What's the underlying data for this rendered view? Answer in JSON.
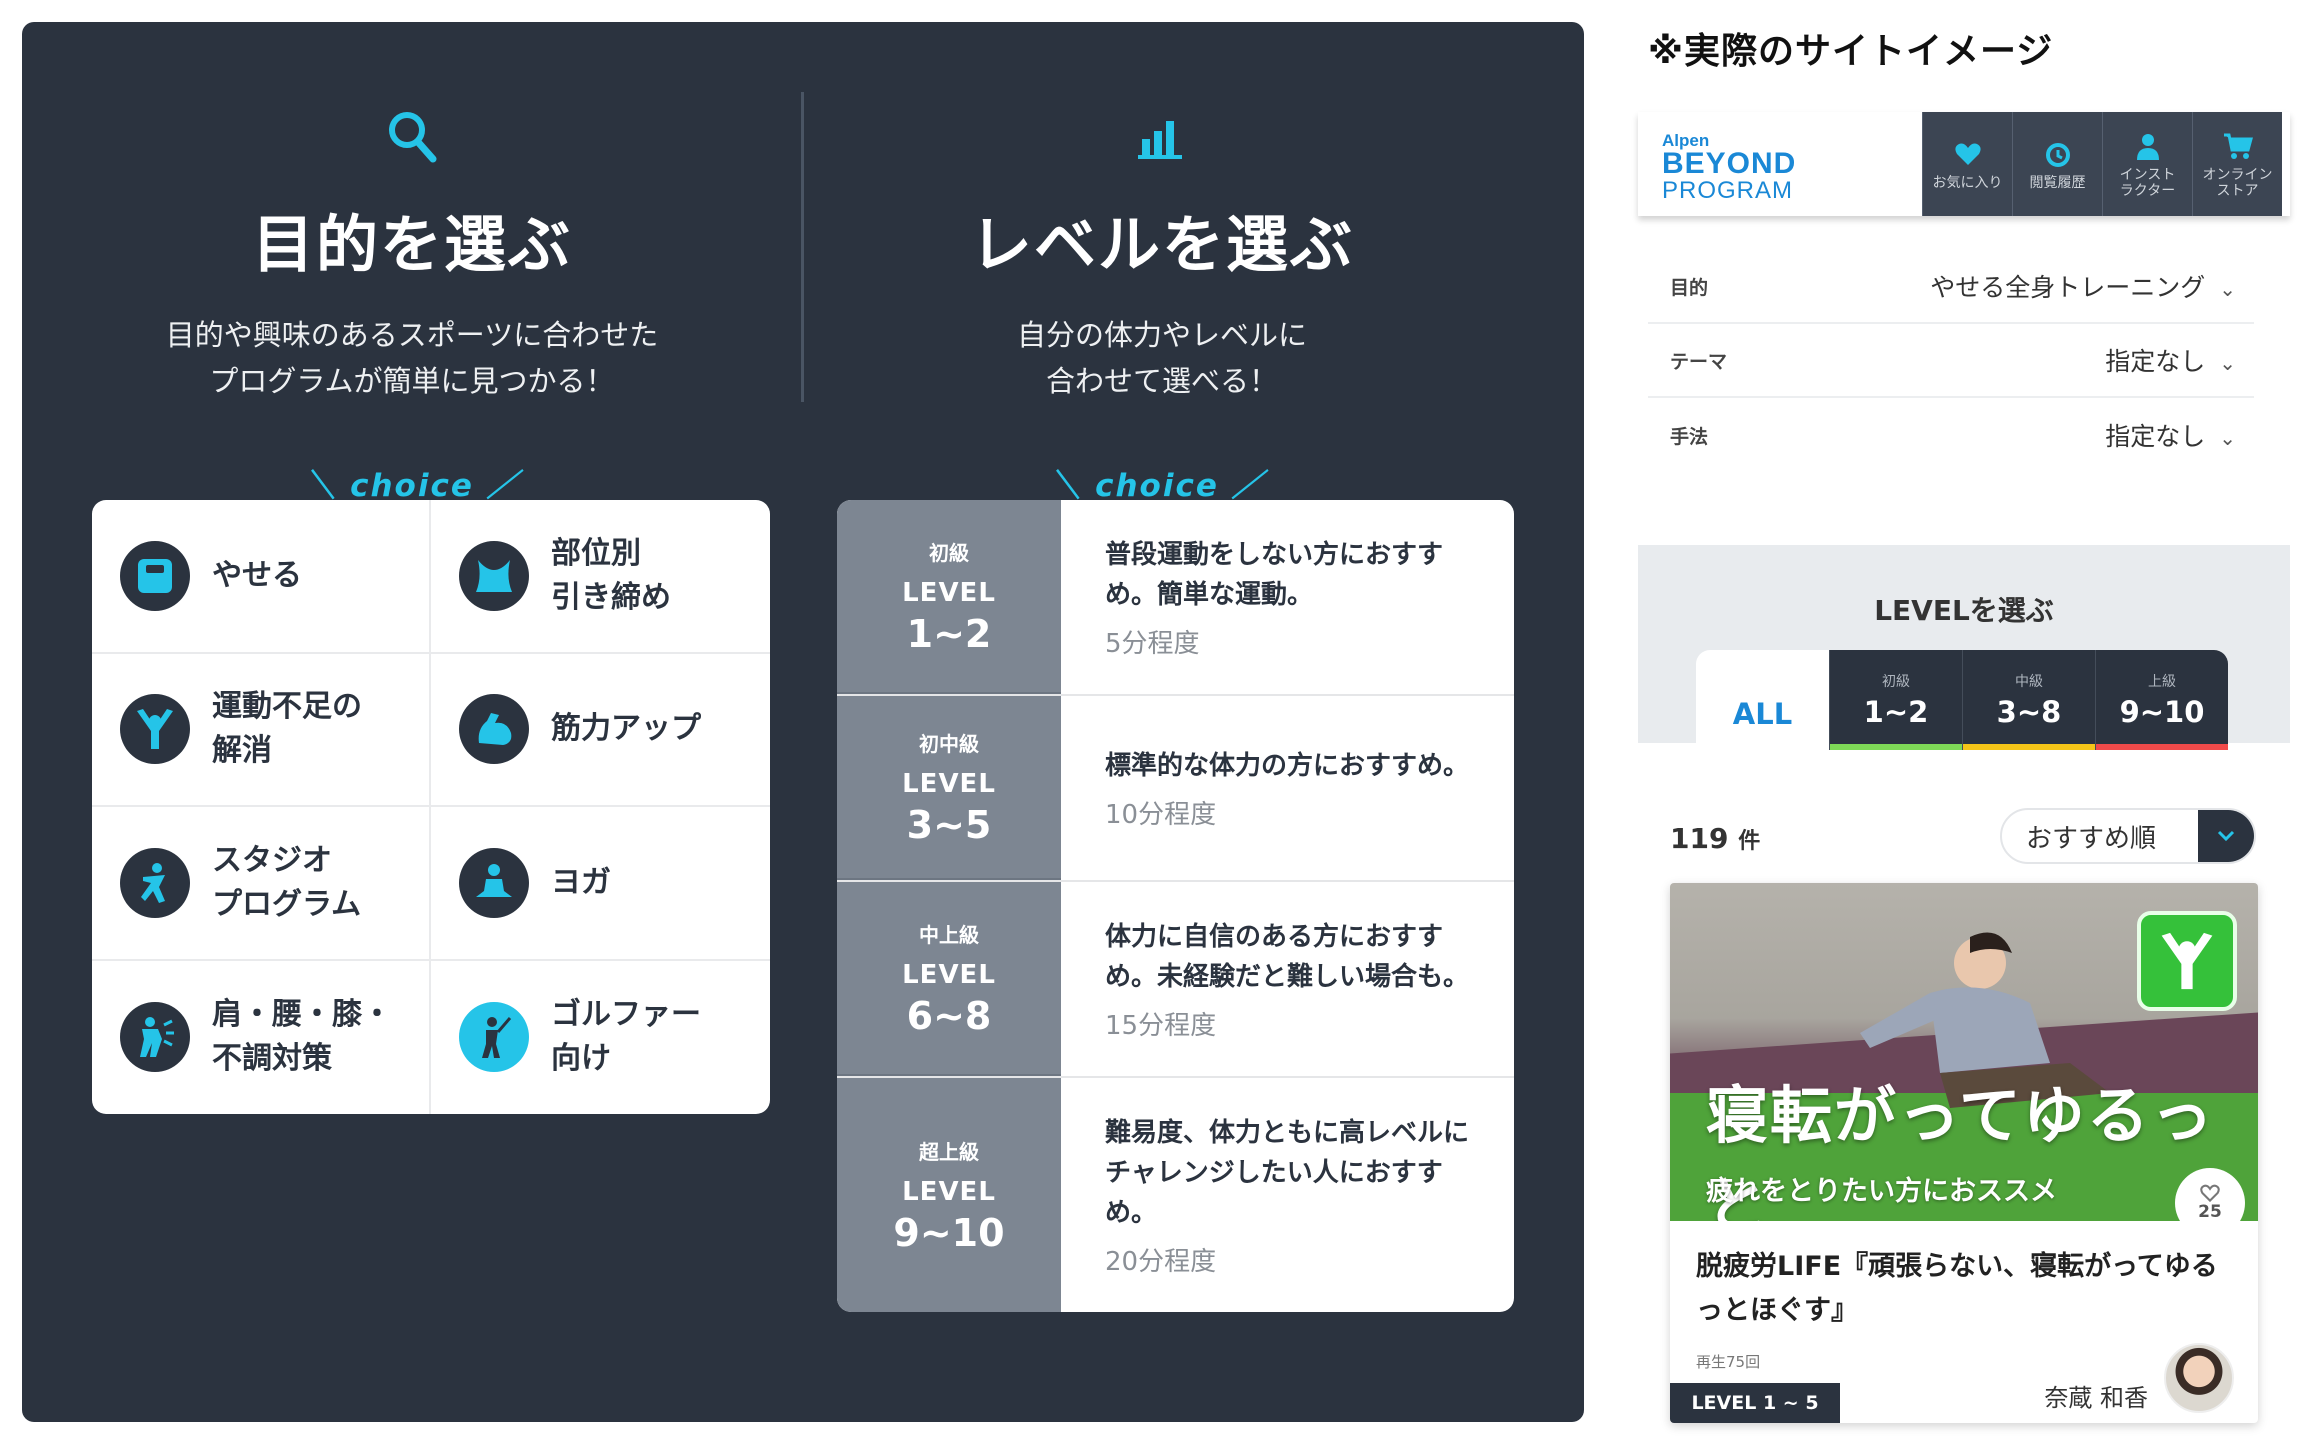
{
  "purpose": {
    "title": "目的を選ぶ",
    "desc": "目的や興味のあるスポーツに合わせた\nプログラムが簡単に見つかる！",
    "choice": "＼ choice ／",
    "items": [
      {
        "label": "やせる",
        "icon": "scale-icon"
      },
      {
        "label": "部位別\n引き締め",
        "icon": "body-icon"
      },
      {
        "label": "運動不足の\n解消",
        "icon": "cheer-icon"
      },
      {
        "label": "筋力アップ",
        "icon": "muscle-icon"
      },
      {
        "label": "スタジオ\nプログラム",
        "icon": "dance-icon"
      },
      {
        "label": "ヨガ",
        "icon": "yoga-icon"
      },
      {
        "label": "肩・腰・膝・\n不調対策",
        "icon": "back-pain-icon"
      },
      {
        "label": "ゴルファー\n向け",
        "icon": "golf-icon"
      }
    ]
  },
  "level": {
    "title": "レベルを選ぶ",
    "desc": "自分の体力やレベルに\n合わせて選べる！",
    "choice": "＼ choice ／",
    "rows": [
      {
        "grade": "初級",
        "level": "LEVEL",
        "range": "1~2",
        "desc": "普段運動をしない方におすす\nめ。簡単な運動。",
        "time": "5分程度"
      },
      {
        "grade": "初中級",
        "level": "LEVEL",
        "range": "3~5",
        "desc": "標準的な体力の方におすすめ。",
        "time": "10分程度"
      },
      {
        "grade": "中上級",
        "level": "LEVEL",
        "range": "6~8",
        "desc": "体力に自信のある方におすす\nめ。未経験だと難しい場合も。",
        "time": "15分程度"
      },
      {
        "grade": "超上級",
        "level": "LEVEL",
        "range": "9~10",
        "desc": "難易度、体力ともに高レベルに\nチャレンジしたい人におすす\nめ。",
        "time": "20分程度"
      }
    ]
  },
  "site": {
    "note": "※実際のサイトイメージ",
    "logo": {
      "l1": "Alpen",
      "l2": "BEYOND",
      "l3": "PROGRAM"
    },
    "nav": [
      {
        "label": "お気に入り",
        "icon": "heart-icon"
      },
      {
        "label": "閲覧履歴",
        "icon": "history-icon"
      },
      {
        "label": "インスト\nラクター",
        "icon": "person-icon"
      },
      {
        "label": "オンライン\nストア",
        "icon": "cart-icon"
      }
    ],
    "filters": [
      {
        "key": "目的",
        "value": "やせる全身トレーニング"
      },
      {
        "key": "テーマ",
        "value": "指定なし"
      },
      {
        "key": "手法",
        "value": "指定なし"
      }
    ],
    "level_title": "LEVELを選ぶ",
    "level_tabs": [
      {
        "grade": "",
        "range": "ALL",
        "color": "#ffffff"
      },
      {
        "grade": "初級",
        "range": "1~2",
        "color": "#7ed957"
      },
      {
        "grade": "中級",
        "range": "3~8",
        "color": "#f5c518"
      },
      {
        "grade": "上級",
        "range": "9~10",
        "color": "#f04a4a"
      }
    ],
    "count": "119",
    "count_unit": "件",
    "sort": "おすすめ順",
    "card": {
      "thumb_title": "寝転がってゆるっと",
      "thumb_sub": "疲れをとりたい方におススメ",
      "likes": "25",
      "title": "脱疲労LIFE『頑張らない、寝転がってゆるっとほぐす』",
      "views": "再生75回",
      "author": "奈蔵 和香",
      "level": "LEVEL 1 ~ 5"
    }
  },
  "colors": {
    "accent": "#25c4e8",
    "panel": "#2b333f",
    "brand": "#1a88d6"
  }
}
